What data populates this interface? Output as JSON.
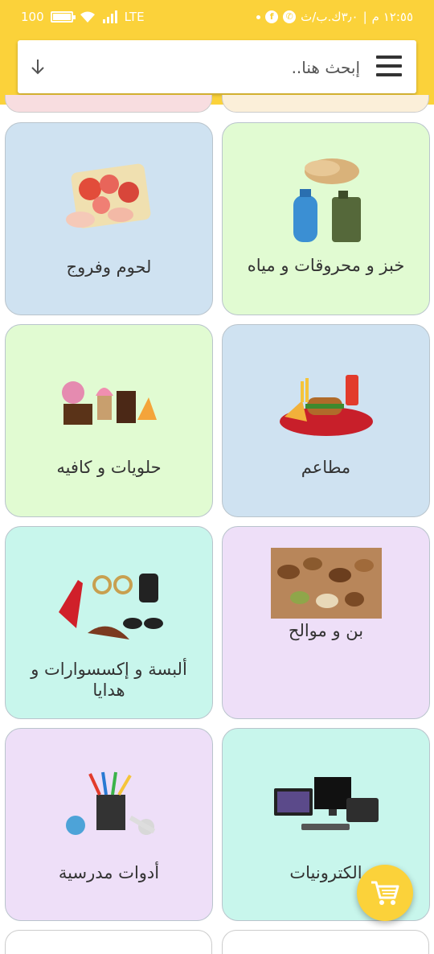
{
  "status_bar": {
    "time": "١٢:٥٥ م",
    "network_speed": "٣٫٠ك.ب/ث",
    "battery": "100",
    "battery_level": 1.0,
    "network": "LTE",
    "whatsapp_icon": "whatsapp-icon",
    "facebook_icon": "facebook-icon"
  },
  "search": {
    "placeholder": "إبحث هنا..",
    "menu_icon": "hamburger-menu-icon",
    "sort_icon": "arrow-down-icon"
  },
  "colors": {
    "header": "#fbd23a",
    "card_blue": "#cfe2f1",
    "card_green": "#e1fbd2",
    "card_mint": "#c8f6ec",
    "card_lavender": "#eedff8",
    "card_pink": "#f8dde0",
    "card_peach": "#fbefd9"
  },
  "categories": [
    {
      "label": "خبز و محروقات و مياه",
      "icon": "bread-gas-water-icon",
      "color": "#e1fbd2"
    },
    {
      "label": "لحوم وفروج",
      "icon": "meat-poultry-icon",
      "color": "#cfe2f1"
    },
    {
      "label": "مطاعم",
      "icon": "restaurant-food-icon",
      "color": "#cfe2f1"
    },
    {
      "label": "حلويات و كافيه",
      "icon": "sweets-cafe-icon",
      "color": "#e1fbd2"
    },
    {
      "label": "بن و موالح",
      "icon": "nuts-coffee-icon",
      "color": "#eedff8"
    },
    {
      "label": "ألبسة و إكسسوارات و هدايا",
      "icon": "clothes-accessories-icon",
      "color": "#c8f6ec"
    },
    {
      "label": "الكترونيات",
      "icon": "electronics-icon",
      "color": "#c8f6ec"
    },
    {
      "label": "أدوات مدرسية",
      "icon": "school-supplies-icon",
      "color": "#eedff8"
    }
  ],
  "cart": {
    "icon": "shopping-cart-icon"
  }
}
